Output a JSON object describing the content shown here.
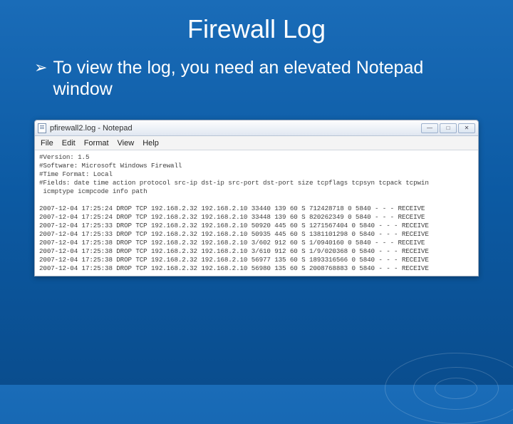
{
  "slide": {
    "title": "Firewall Log",
    "bullet": "To view the log, you need an elevated Notepad window"
  },
  "notepad": {
    "title": "pfirewall2.log - Notepad",
    "menus": [
      "File",
      "Edit",
      "Format",
      "View",
      "Help"
    ],
    "win_min": "—",
    "win_max": "□",
    "win_close": "✕",
    "header_lines": [
      "#Version: 1.5",
      "#Software: Microsoft Windows Firewall",
      "#Time Format: Local",
      "#Fields: date time action protocol src-ip dst-ip src-port dst-port size tcpflags tcpsyn tcpack tcpwin",
      " icmptype icmpcode info path"
    ],
    "rows": [
      [
        "2007-12-04",
        "17:25:24",
        "DROP",
        "TCP",
        "192.168.2.32",
        "192.168.2.10",
        "33440",
        "139",
        "60",
        "S",
        "712428718",
        "0",
        "5840",
        "-",
        "-",
        "-",
        "RECEIVE"
      ],
      [
        "2007-12-04",
        "17:25:24",
        "DROP",
        "TCP",
        "192.168.2.32",
        "192.168.2.10",
        "33448",
        "139",
        "60",
        "S",
        "820262349",
        "0",
        "5840",
        "-",
        "-",
        "-",
        "RECEIVE"
      ],
      [
        "2007-12-04",
        "17:25:33",
        "DROP",
        "TCP",
        "192.168.2.32",
        "192.168.2.10",
        "50920",
        "445",
        "60",
        "S",
        "1271567404",
        "0",
        "5840",
        "-",
        "-",
        "-",
        "RECEIVE"
      ],
      [
        "2007-12-04",
        "17:25:33",
        "DROP",
        "TCP",
        "192.168.2.32",
        "192.168.2.10",
        "50935",
        "445",
        "60",
        "S",
        "1381101298",
        "0",
        "5840",
        "-",
        "-",
        "-",
        "RECEIVE"
      ],
      [
        "2007-12-04",
        "17:25:38",
        "DROP",
        "TCP",
        "192.168.2.32",
        "192.168.2.10",
        "3/602",
        "912",
        "60",
        "S",
        "1/0940160",
        "0",
        "5840",
        "-",
        "-",
        "-",
        "RECEIVE"
      ],
      [
        "2007-12-04",
        "17:25:38",
        "DROP",
        "TCP",
        "192.168.2.32",
        "192.168.2.10",
        "3/610",
        "912",
        "60",
        "S",
        "1/9/020368",
        "0",
        "5840",
        "-",
        "-",
        "-",
        "RECEIVE"
      ],
      [
        "2007-12-04",
        "17:25:38",
        "DROP",
        "TCP",
        "192.168.2.32",
        "192.168.2.10",
        "56977",
        "135",
        "60",
        "S",
        "1893316566",
        "0",
        "5840",
        "-",
        "-",
        "-",
        "RECEIVE"
      ],
      [
        "2007-12-04",
        "17:25:38",
        "DROP",
        "TCP",
        "192.168.2.32",
        "192.168.2.10",
        "56980",
        "135",
        "60",
        "S",
        "2008768883",
        "0",
        "5840",
        "-",
        "-",
        "-",
        "RECEIVE"
      ]
    ]
  }
}
